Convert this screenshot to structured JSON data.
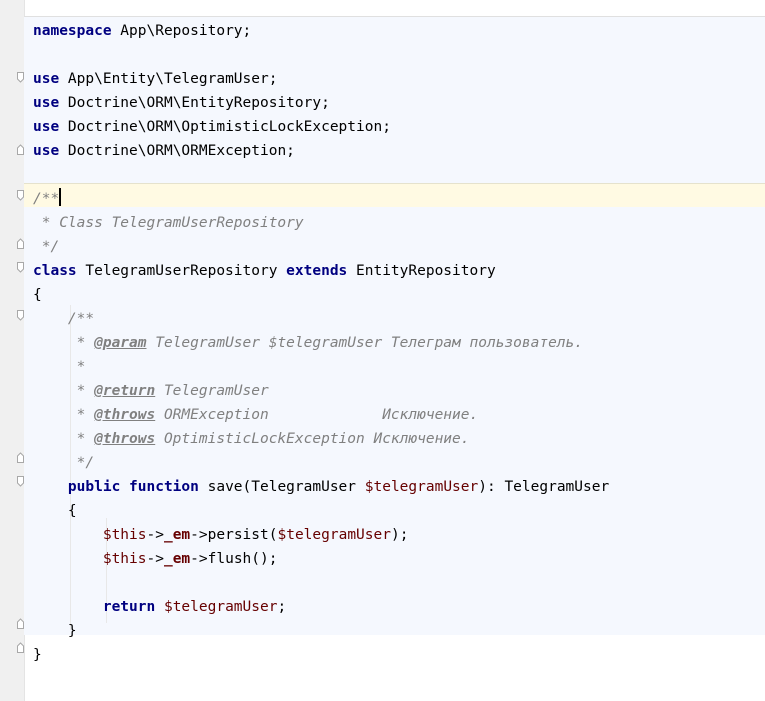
{
  "editor": {
    "lines": [
      {
        "tokens": [
          {
            "t": "kw",
            "v": "namespace"
          },
          {
            "t": "plain",
            "v": " App\\Repository;"
          }
        ]
      },
      {
        "tokens": []
      },
      {
        "tokens": [
          {
            "t": "kw",
            "v": "use"
          },
          {
            "t": "plain",
            "v": " App\\Entity\\TelegramUser;"
          }
        ]
      },
      {
        "tokens": [
          {
            "t": "kw",
            "v": "use"
          },
          {
            "t": "plain",
            "v": " Doctrine\\ORM\\EntityRepository;"
          }
        ]
      },
      {
        "tokens": [
          {
            "t": "kw",
            "v": "use"
          },
          {
            "t": "plain",
            "v": " Doctrine\\ORM\\OptimisticLockException;"
          }
        ]
      },
      {
        "tokens": [
          {
            "t": "kw",
            "v": "use"
          },
          {
            "t": "plain",
            "v": " Doctrine\\ORM\\ORMException;"
          }
        ]
      },
      {
        "tokens": []
      },
      {
        "tokens": [
          {
            "t": "cm",
            "v": "/**"
          }
        ],
        "caret": true
      },
      {
        "tokens": [
          {
            "t": "cm",
            "v": " * Class TelegramUserRepository"
          }
        ]
      },
      {
        "tokens": [
          {
            "t": "cm",
            "v": " */"
          }
        ]
      },
      {
        "tokens": [
          {
            "t": "kw",
            "v": "class"
          },
          {
            "t": "plain",
            "v": " TelegramUserRepository "
          },
          {
            "t": "kw",
            "v": "extends"
          },
          {
            "t": "plain",
            "v": " EntityRepository"
          }
        ]
      },
      {
        "tokens": [
          {
            "t": "plain",
            "v": "{"
          }
        ]
      },
      {
        "tokens": [
          {
            "t": "cm",
            "v": "    /**"
          }
        ]
      },
      {
        "tokens": [
          {
            "t": "cm",
            "v": "     * "
          },
          {
            "t": "doctag",
            "v": "@param"
          },
          {
            "t": "cm",
            "v": " TelegramUser $telegramUser Телеграм пользователь."
          }
        ]
      },
      {
        "tokens": [
          {
            "t": "cm",
            "v": "     *"
          }
        ]
      },
      {
        "tokens": [
          {
            "t": "cm",
            "v": "     * "
          },
          {
            "t": "doctag",
            "v": "@return"
          },
          {
            "t": "cm",
            "v": " TelegramUser"
          }
        ]
      },
      {
        "tokens": [
          {
            "t": "cm",
            "v": "     * "
          },
          {
            "t": "doctag",
            "v": "@throws"
          },
          {
            "t": "cm",
            "v": " ORMException             Исключение."
          }
        ]
      },
      {
        "tokens": [
          {
            "t": "cm",
            "v": "     * "
          },
          {
            "t": "doctag",
            "v": "@throws"
          },
          {
            "t": "cm",
            "v": " OptimisticLockException Исключение."
          }
        ]
      },
      {
        "tokens": [
          {
            "t": "cm",
            "v": "     */"
          }
        ]
      },
      {
        "tokens": [
          {
            "t": "plain",
            "v": "    "
          },
          {
            "t": "kw",
            "v": "public function"
          },
          {
            "t": "plain",
            "v": " save(TelegramUser "
          },
          {
            "t": "var",
            "v": "$telegramUser"
          },
          {
            "t": "plain",
            "v": "): TelegramUser"
          }
        ]
      },
      {
        "tokens": [
          {
            "t": "plain",
            "v": "    {"
          }
        ]
      },
      {
        "tokens": [
          {
            "t": "plain",
            "v": "        "
          },
          {
            "t": "var",
            "v": "$this"
          },
          {
            "t": "plain",
            "v": "->"
          },
          {
            "t": "field",
            "v": "_em"
          },
          {
            "t": "plain",
            "v": "->persist("
          },
          {
            "t": "var",
            "v": "$telegramUser"
          },
          {
            "t": "plain",
            "v": ");"
          }
        ]
      },
      {
        "tokens": [
          {
            "t": "plain",
            "v": "        "
          },
          {
            "t": "var",
            "v": "$this"
          },
          {
            "t": "plain",
            "v": "->"
          },
          {
            "t": "field",
            "v": "_em"
          },
          {
            "t": "plain",
            "v": "->flush();"
          }
        ]
      },
      {
        "tokens": []
      },
      {
        "tokens": [
          {
            "t": "plain",
            "v": "        "
          },
          {
            "t": "kw",
            "v": "return"
          },
          {
            "t": "plain",
            "v": " "
          },
          {
            "t": "var",
            "v": "$telegramUser"
          },
          {
            "t": "plain",
            "v": ";"
          }
        ]
      },
      {
        "tokens": [
          {
            "t": "plain",
            "v": "    }"
          }
        ]
      },
      {
        "tokens": [
          {
            "t": "plain",
            "v": "}"
          }
        ]
      }
    ]
  },
  "colors": {
    "keyword": "#000080",
    "comment": "#808080",
    "variable": "#660000",
    "gutter": "#f0f0f0",
    "block_highlight": "#f5f8fe",
    "caret_line": "#fffae3"
  }
}
